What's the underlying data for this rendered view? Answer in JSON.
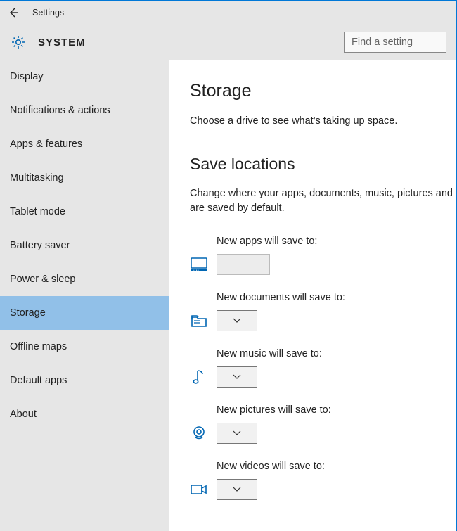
{
  "titlebar": {
    "title": "Settings"
  },
  "header": {
    "system_label": "SYSTEM",
    "search_placeholder": "Find a setting"
  },
  "sidebar": {
    "items": [
      {
        "label": "Display",
        "selected": false
      },
      {
        "label": "Notifications & actions",
        "selected": false
      },
      {
        "label": "Apps & features",
        "selected": false
      },
      {
        "label": "Multitasking",
        "selected": false
      },
      {
        "label": "Tablet mode",
        "selected": false
      },
      {
        "label": "Battery saver",
        "selected": false
      },
      {
        "label": "Power & sleep",
        "selected": false
      },
      {
        "label": "Storage",
        "selected": true
      },
      {
        "label": "Offline maps",
        "selected": false
      },
      {
        "label": "Default apps",
        "selected": false
      },
      {
        "label": "About",
        "selected": false
      }
    ]
  },
  "main": {
    "heading": "Storage",
    "description": "Choose a drive to see what's taking up space.",
    "save_locations_heading": "Save locations",
    "save_locations_desc": "Change where your apps, documents, music, pictures and are saved by default.",
    "rows": [
      {
        "label": "New apps will save to:",
        "icon": "monitor-icon",
        "disabled": true
      },
      {
        "label": "New documents will save to:",
        "icon": "folder-icon",
        "disabled": false
      },
      {
        "label": "New music will save to:",
        "icon": "music-note-icon",
        "disabled": false
      },
      {
        "label": "New pictures will save to:",
        "icon": "camera-icon",
        "disabled": false
      },
      {
        "label": "New videos will save to:",
        "icon": "video-camera-icon",
        "disabled": false
      }
    ]
  }
}
